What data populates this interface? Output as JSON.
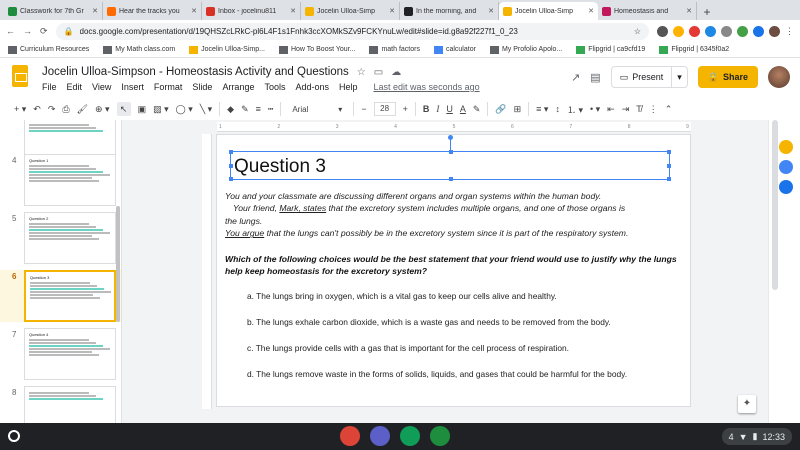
{
  "browser": {
    "tabs": [
      {
        "title": "Classwork for 7th Gr",
        "favicon_color": "#1e8e3e"
      },
      {
        "title": "Hear the tracks you",
        "favicon_color": "#ff6b00"
      },
      {
        "title": "Inbox - jocelinu811",
        "favicon_color": "#d93025"
      },
      {
        "title": "Jocelin Ulloa-Simp",
        "favicon_color": "#f4b400"
      },
      {
        "title": "In the morning, and",
        "favicon_color": "#202124"
      },
      {
        "title": "Jocelin Ulloa-Simp",
        "favicon_color": "#f4b400",
        "active": true
      },
      {
        "title": "Homeostasis and",
        "favicon_color": "#c2185b"
      }
    ],
    "new_tab_label": "+",
    "close_label": "✕",
    "url": "docs.google.com/presentation/d/19QHSZcLRkC-pl6L4F1s1Fnhk3ccXOMkSZv9FCKYnuLw/edit#slide=id.g8a92f227f1_0_23",
    "bookmarks": [
      {
        "label": "Curriculum Resources",
        "color": "#5f6368"
      },
      {
        "label": "My Math class.com",
        "color": "#5f6368"
      },
      {
        "label": "Jocelin Ulloa-Simp...",
        "color": "#f4b400"
      },
      {
        "label": "How To Boost Your...",
        "color": "#5f6368"
      },
      {
        "label": "math factors",
        "color": "#5f6368"
      },
      {
        "label": "calculator",
        "color": "#4285f4"
      },
      {
        "label": "My Profolio Apolo...",
        "color": "#5f6368"
      },
      {
        "label": "Flipgrid | ca9cfd19",
        "color": "#34a853"
      },
      {
        "label": "Flipgrid | 6345f0a2",
        "color": "#34a853"
      }
    ]
  },
  "doc": {
    "title": "Jocelin Ulloa-Simpson - Homeostasis Activity and Questions",
    "menus": [
      "File",
      "Edit",
      "View",
      "Insert",
      "Format",
      "Slide",
      "Arrange",
      "Tools",
      "Add-ons",
      "Help"
    ],
    "saved_status": "Last edit was seconds ago",
    "present_label": "Present",
    "share_label": "Share"
  },
  "toolbar": {
    "font": "Arial",
    "font_size": "28",
    "bold": "B",
    "italic": "I",
    "underline": "U",
    "text_color": "A"
  },
  "filmstrip": {
    "slides": [
      {
        "number": "",
        "title": ""
      },
      {
        "number": "4",
        "title": "Question 1"
      },
      {
        "number": "5",
        "title": "Question 2"
      },
      {
        "number": "6",
        "title": "Question 3",
        "selected": true
      },
      {
        "number": "7",
        "title": "Question 4"
      },
      {
        "number": "8",
        "title": ""
      }
    ]
  },
  "slide": {
    "title": "Question 3",
    "scenario_line1": "You and your classmate are discussing different organs and organ systems within the human body.",
    "scenario_line2_prefix": "Your friend, ",
    "scenario_line2_underlined": "Mark, states",
    "scenario_line2_suffix": " that the excretory system includes multiple organs, and one of those organs is",
    "scenario_line3": "the lungs.",
    "scenario_line4_underlined": "You argue",
    "scenario_line4_suffix": " that the lungs can't possibly be in the excretory system since it is part of the respiratory system.",
    "question": "Which of the following choices would be the best statement that your friend would use to justify why the lungs help keep homeostasis for the excretory system?",
    "choices": [
      "a. The lungs bring in oxygen, which is a vital gas to keep our cells alive and healthy.",
      "b. The lungs exhale carbon dioxide, which is a waste gas and needs to be removed from the body.",
      "c. The lungs provide cells with a gas that is important for the cell process of respiration.",
      "d. The lungs remove waste in the forms of solids, liquids, and gases that could be harmful for the body."
    ]
  },
  "shelf": {
    "apps": [
      {
        "name": "chrome",
        "color": "#db4437"
      },
      {
        "name": "teams",
        "color": "#5b5fc7"
      },
      {
        "name": "drive",
        "color": "#0f9d58"
      },
      {
        "name": "classroom",
        "color": "#1e8e3e"
      }
    ],
    "time": "12:33",
    "battery_level": "4"
  }
}
